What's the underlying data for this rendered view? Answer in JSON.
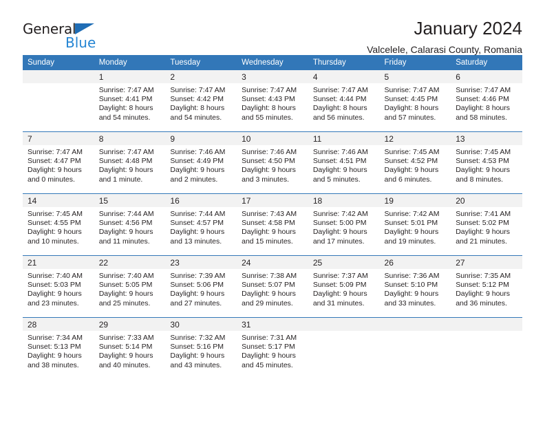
{
  "brand": {
    "name_part1": "General",
    "name_part2": "Blue",
    "triangle_color": "#1f6db5",
    "blue_color": "#2585d3"
  },
  "header": {
    "title": "January 2024",
    "subtitle": "Valcelele, Calarasi County, Romania"
  },
  "theme": {
    "header_bg": "#3277b8",
    "daynum_bg": "#f2f2f2",
    "text": "#231f20"
  },
  "weekdays": [
    "Sunday",
    "Monday",
    "Tuesday",
    "Wednesday",
    "Thursday",
    "Friday",
    "Saturday"
  ],
  "weeks": [
    [
      {
        "day": "",
        "sunrise": "",
        "sunset": "",
        "daylight_line1": "",
        "daylight_line2": "",
        "empty": true
      },
      {
        "day": "1",
        "sunrise": "Sunrise: 7:47 AM",
        "sunset": "Sunset: 4:41 PM",
        "daylight_line1": "Daylight: 8 hours",
        "daylight_line2": "and 54 minutes."
      },
      {
        "day": "2",
        "sunrise": "Sunrise: 7:47 AM",
        "sunset": "Sunset: 4:42 PM",
        "daylight_line1": "Daylight: 8 hours",
        "daylight_line2": "and 54 minutes."
      },
      {
        "day": "3",
        "sunrise": "Sunrise: 7:47 AM",
        "sunset": "Sunset: 4:43 PM",
        "daylight_line1": "Daylight: 8 hours",
        "daylight_line2": "and 55 minutes."
      },
      {
        "day": "4",
        "sunrise": "Sunrise: 7:47 AM",
        "sunset": "Sunset: 4:44 PM",
        "daylight_line1": "Daylight: 8 hours",
        "daylight_line2": "and 56 minutes."
      },
      {
        "day": "5",
        "sunrise": "Sunrise: 7:47 AM",
        "sunset": "Sunset: 4:45 PM",
        "daylight_line1": "Daylight: 8 hours",
        "daylight_line2": "and 57 minutes."
      },
      {
        "day": "6",
        "sunrise": "Sunrise: 7:47 AM",
        "sunset": "Sunset: 4:46 PM",
        "daylight_line1": "Daylight: 8 hours",
        "daylight_line2": "and 58 minutes."
      }
    ],
    [
      {
        "day": "7",
        "sunrise": "Sunrise: 7:47 AM",
        "sunset": "Sunset: 4:47 PM",
        "daylight_line1": "Daylight: 9 hours",
        "daylight_line2": "and 0 minutes."
      },
      {
        "day": "8",
        "sunrise": "Sunrise: 7:47 AM",
        "sunset": "Sunset: 4:48 PM",
        "daylight_line1": "Daylight: 9 hours",
        "daylight_line2": "and 1 minute."
      },
      {
        "day": "9",
        "sunrise": "Sunrise: 7:46 AM",
        "sunset": "Sunset: 4:49 PM",
        "daylight_line1": "Daylight: 9 hours",
        "daylight_line2": "and 2 minutes."
      },
      {
        "day": "10",
        "sunrise": "Sunrise: 7:46 AM",
        "sunset": "Sunset: 4:50 PM",
        "daylight_line1": "Daylight: 9 hours",
        "daylight_line2": "and 3 minutes."
      },
      {
        "day": "11",
        "sunrise": "Sunrise: 7:46 AM",
        "sunset": "Sunset: 4:51 PM",
        "daylight_line1": "Daylight: 9 hours",
        "daylight_line2": "and 5 minutes."
      },
      {
        "day": "12",
        "sunrise": "Sunrise: 7:45 AM",
        "sunset": "Sunset: 4:52 PM",
        "daylight_line1": "Daylight: 9 hours",
        "daylight_line2": "and 6 minutes."
      },
      {
        "day": "13",
        "sunrise": "Sunrise: 7:45 AM",
        "sunset": "Sunset: 4:53 PM",
        "daylight_line1": "Daylight: 9 hours",
        "daylight_line2": "and 8 minutes."
      }
    ],
    [
      {
        "day": "14",
        "sunrise": "Sunrise: 7:45 AM",
        "sunset": "Sunset: 4:55 PM",
        "daylight_line1": "Daylight: 9 hours",
        "daylight_line2": "and 10 minutes."
      },
      {
        "day": "15",
        "sunrise": "Sunrise: 7:44 AM",
        "sunset": "Sunset: 4:56 PM",
        "daylight_line1": "Daylight: 9 hours",
        "daylight_line2": "and 11 minutes."
      },
      {
        "day": "16",
        "sunrise": "Sunrise: 7:44 AM",
        "sunset": "Sunset: 4:57 PM",
        "daylight_line1": "Daylight: 9 hours",
        "daylight_line2": "and 13 minutes."
      },
      {
        "day": "17",
        "sunrise": "Sunrise: 7:43 AM",
        "sunset": "Sunset: 4:58 PM",
        "daylight_line1": "Daylight: 9 hours",
        "daylight_line2": "and 15 minutes."
      },
      {
        "day": "18",
        "sunrise": "Sunrise: 7:42 AM",
        "sunset": "Sunset: 5:00 PM",
        "daylight_line1": "Daylight: 9 hours",
        "daylight_line2": "and 17 minutes."
      },
      {
        "day": "19",
        "sunrise": "Sunrise: 7:42 AM",
        "sunset": "Sunset: 5:01 PM",
        "daylight_line1": "Daylight: 9 hours",
        "daylight_line2": "and 19 minutes."
      },
      {
        "day": "20",
        "sunrise": "Sunrise: 7:41 AM",
        "sunset": "Sunset: 5:02 PM",
        "daylight_line1": "Daylight: 9 hours",
        "daylight_line2": "and 21 minutes."
      }
    ],
    [
      {
        "day": "21",
        "sunrise": "Sunrise: 7:40 AM",
        "sunset": "Sunset: 5:03 PM",
        "daylight_line1": "Daylight: 9 hours",
        "daylight_line2": "and 23 minutes."
      },
      {
        "day": "22",
        "sunrise": "Sunrise: 7:40 AM",
        "sunset": "Sunset: 5:05 PM",
        "daylight_line1": "Daylight: 9 hours",
        "daylight_line2": "and 25 minutes."
      },
      {
        "day": "23",
        "sunrise": "Sunrise: 7:39 AM",
        "sunset": "Sunset: 5:06 PM",
        "daylight_line1": "Daylight: 9 hours",
        "daylight_line2": "and 27 minutes."
      },
      {
        "day": "24",
        "sunrise": "Sunrise: 7:38 AM",
        "sunset": "Sunset: 5:07 PM",
        "daylight_line1": "Daylight: 9 hours",
        "daylight_line2": "and 29 minutes."
      },
      {
        "day": "25",
        "sunrise": "Sunrise: 7:37 AM",
        "sunset": "Sunset: 5:09 PM",
        "daylight_line1": "Daylight: 9 hours",
        "daylight_line2": "and 31 minutes."
      },
      {
        "day": "26",
        "sunrise": "Sunrise: 7:36 AM",
        "sunset": "Sunset: 5:10 PM",
        "daylight_line1": "Daylight: 9 hours",
        "daylight_line2": "and 33 minutes."
      },
      {
        "day": "27",
        "sunrise": "Sunrise: 7:35 AM",
        "sunset": "Sunset: 5:12 PM",
        "daylight_line1": "Daylight: 9 hours",
        "daylight_line2": "and 36 minutes."
      }
    ],
    [
      {
        "day": "28",
        "sunrise": "Sunrise: 7:34 AM",
        "sunset": "Sunset: 5:13 PM",
        "daylight_line1": "Daylight: 9 hours",
        "daylight_line2": "and 38 minutes."
      },
      {
        "day": "29",
        "sunrise": "Sunrise: 7:33 AM",
        "sunset": "Sunset: 5:14 PM",
        "daylight_line1": "Daylight: 9 hours",
        "daylight_line2": "and 40 minutes."
      },
      {
        "day": "30",
        "sunrise": "Sunrise: 7:32 AM",
        "sunset": "Sunset: 5:16 PM",
        "daylight_line1": "Daylight: 9 hours",
        "daylight_line2": "and 43 minutes."
      },
      {
        "day": "31",
        "sunrise": "Sunrise: 7:31 AM",
        "sunset": "Sunset: 5:17 PM",
        "daylight_line1": "Daylight: 9 hours",
        "daylight_line2": "and 45 minutes."
      },
      {
        "day": "",
        "sunrise": "",
        "sunset": "",
        "daylight_line1": "",
        "daylight_line2": "",
        "empty": true
      },
      {
        "day": "",
        "sunrise": "",
        "sunset": "",
        "daylight_line1": "",
        "daylight_line2": "",
        "empty": true
      },
      {
        "day": "",
        "sunrise": "",
        "sunset": "",
        "daylight_line1": "",
        "daylight_line2": "",
        "empty": true
      }
    ]
  ]
}
